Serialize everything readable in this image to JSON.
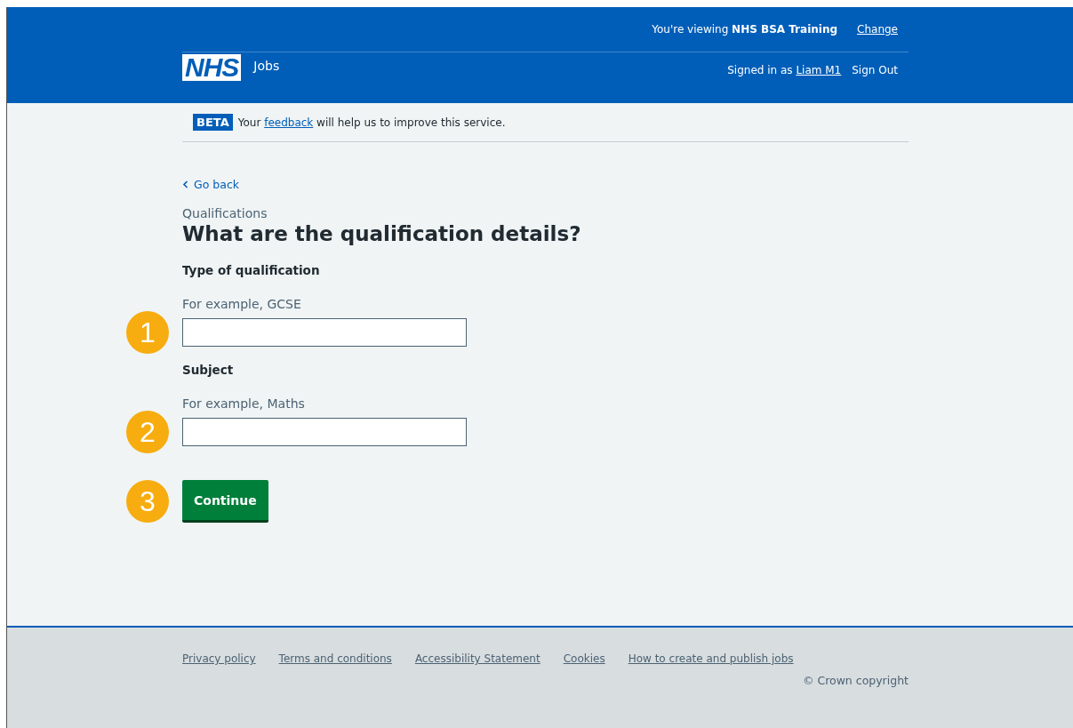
{
  "header": {
    "logo": "NHS",
    "service": "Jobs",
    "viewing_prefix": "You're viewing ",
    "viewing_org": "NHS BSA Training",
    "change_link": "Change",
    "signed_in_prefix": "Signed in as ",
    "user_link": "Liam M1",
    "sign_out": "Sign Out"
  },
  "beta_banner": {
    "tag": "BETA",
    "text_before": "Your ",
    "link": "feedback",
    "text_after": " will help us to improve this service."
  },
  "back_link": "Go back",
  "caption": "Qualifications",
  "heading": "What are the qualification details?",
  "fields": [
    {
      "label": "Type of qualification",
      "hint": "For example, GCSE",
      "badge": "1"
    },
    {
      "label": "Subject",
      "hint": "For example, Maths",
      "badge": "2"
    }
  ],
  "button": {
    "label": "Continue",
    "badge": "3"
  },
  "footer": {
    "links": [
      "Privacy policy",
      "Terms and conditions",
      "Accessibility Statement",
      "Cookies",
      "How to create and publish jobs"
    ],
    "copyright": "© Crown copyright"
  }
}
